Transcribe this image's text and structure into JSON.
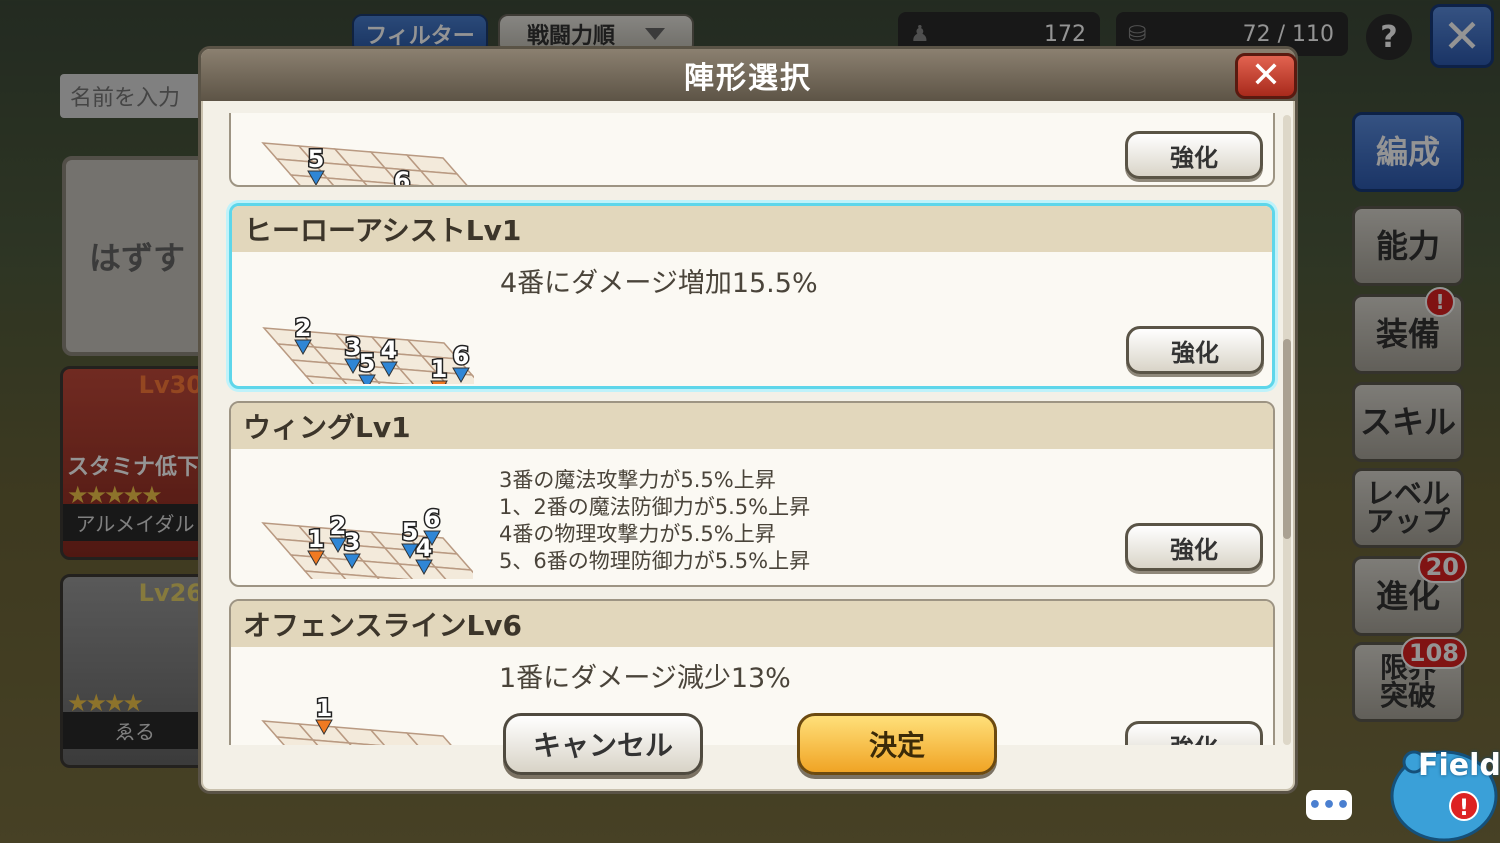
{
  "background": {
    "filter_label": "フィルター",
    "sort_label": "戦闘力順",
    "unit_count": "172",
    "capacity": "72 / 110",
    "help_label": "?",
    "close_label": "✕",
    "name_input_placeholder": "名前を入力",
    "remove_label": "はずす",
    "characters": [
      {
        "level": "Lv30",
        "status": "スタミナ低下",
        "stars": "★★★★★",
        "name": "アルメイダル"
      },
      {
        "level": "Lv26",
        "status": "",
        "stars": "★★★★",
        "name": "ゑる"
      }
    ],
    "side_tabs": [
      {
        "label": "編成",
        "active": true,
        "badge": ""
      },
      {
        "label": "能力",
        "active": false,
        "badge": ""
      },
      {
        "label": "装備",
        "active": false,
        "badge": "!"
      },
      {
        "label": "スキル",
        "active": false,
        "badge": ""
      },
      {
        "label": "レベルアップ",
        "active": false,
        "badge": ""
      },
      {
        "label": "進化",
        "active": false,
        "badge": "20"
      },
      {
        "label": "限界突破",
        "active": false,
        "badge": "108"
      }
    ],
    "field_label": "Field",
    "chat_label": "•••"
  },
  "modal": {
    "title": "陣形選択",
    "close_label": "✕",
    "formations": [
      {
        "name": "",
        "description": [],
        "enhance_label": "強化",
        "selected": false,
        "markers": [
          {
            "n": "5",
            "c": "blue"
          },
          {
            "n": "6",
            "c": "blue"
          }
        ]
      },
      {
        "name": "ヒーローアシストLv1",
        "description": [
          "4番にダメージ増加15.5%"
        ],
        "enhance_label": "強化",
        "selected": true,
        "markers": [
          {
            "n": "2",
            "c": "blue"
          },
          {
            "n": "3",
            "c": "blue"
          },
          {
            "n": "4",
            "c": "blue"
          },
          {
            "n": "1",
            "c": "orange"
          },
          {
            "n": "5",
            "c": "blue"
          },
          {
            "n": "6",
            "c": "blue"
          }
        ]
      },
      {
        "name": "ウィングLv1",
        "description": [
          "3番の魔法攻撃力が5.5%上昇",
          "1、2番の魔法防御力が5.5%上昇",
          "4番の物理攻撃力が5.5%上昇",
          "5、6番の物理防御力が5.5%上昇"
        ],
        "enhance_label": "強化",
        "selected": false,
        "markers": [
          {
            "n": "1",
            "c": "orange"
          },
          {
            "n": "2",
            "c": "blue"
          },
          {
            "n": "3",
            "c": "blue"
          },
          {
            "n": "5",
            "c": "blue"
          },
          {
            "n": "4",
            "c": "blue"
          },
          {
            "n": "6",
            "c": "blue"
          }
        ]
      },
      {
        "name": "オフェンスラインLv6",
        "description": [
          "1番にダメージ減少13%"
        ],
        "enhance_label": "強化",
        "selected": false,
        "markers": [
          {
            "n": "1",
            "c": "orange"
          }
        ]
      }
    ],
    "cancel_label": "キャンセル",
    "ok_label": "決定"
  },
  "colors": {
    "marker_blue": "#2f86d6",
    "marker_orange": "#f07a22",
    "selected_border": "#5ed6ea",
    "ok_button": "#f7c04a"
  }
}
